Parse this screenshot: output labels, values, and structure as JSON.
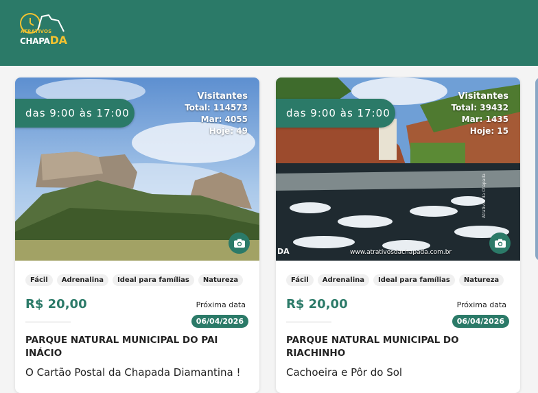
{
  "brand": {
    "line1": "ATRATIVOS",
    "line2a": "CHAPA",
    "line2b": "DA"
  },
  "colors": {
    "primary": "#2b7a68",
    "accent": "#f2c230"
  },
  "cards": [
    {
      "hours": "das 9:00 às 17:00",
      "visitors": {
        "title": "Visitantes",
        "total": "Total: 114573",
        "month": "Mar: 4055",
        "today": "Hoje: 49"
      },
      "camera_icon": "camera-icon",
      "tags": [
        "Fácil",
        "Adrenalina",
        "Ideal para famílias",
        "Natureza"
      ],
      "price": "R$ 20,00",
      "next_label": "Próxima data",
      "date": "06/04/2026",
      "title": "PARQUE NATURAL MUNICIPAL DO PAI INÁCIO",
      "subtitle": "O Cartão Postal da Chapada Diamantina !"
    },
    {
      "hours": "das 9:00 às 17:00",
      "visitors": {
        "title": "Visitantes",
        "total": "Total: 39432",
        "month": "Mar: 1435",
        "today": "Hoje: 15"
      },
      "camera_icon": "camera-icon",
      "tags": [
        "Fácil",
        "Adrenalina",
        "Ideal para famílias",
        "Natureza"
      ],
      "price": "R$ 20,00",
      "next_label": "Próxima data",
      "date": "06/04/2026",
      "title": "PARQUE NATURAL MUNICIPAL DO RIACHINHO",
      "subtitle": "Cachoeira e Pôr do Sol",
      "photo_watermark": "www.atrativosdachapada.com.br",
      "photo_side_text": "Atrativos da Chapada",
      "photo_logo": "DA"
    }
  ]
}
